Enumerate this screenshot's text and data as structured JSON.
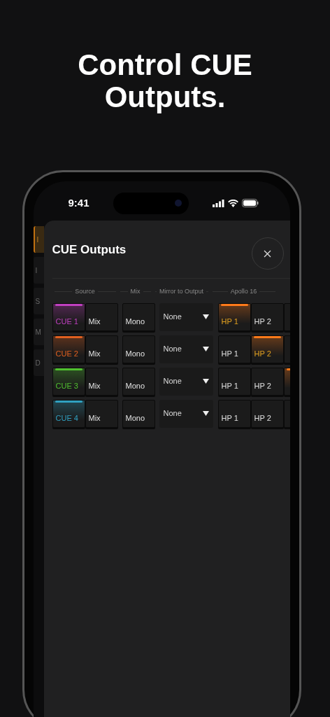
{
  "headline": "Control CUE Outputs.",
  "status_bar": {
    "time": "9:41"
  },
  "background_sidebar": [
    {
      "label": "I",
      "selected": true
    },
    {
      "label": "I",
      "selected": false
    },
    {
      "label": "S",
      "selected": false
    },
    {
      "label": "M",
      "selected": false
    },
    {
      "label": "D",
      "selected": false
    }
  ],
  "sheet": {
    "title": "CUE Outputs",
    "columns": [
      "Source",
      "Mix",
      "Mirror to Output",
      "Apollo 16"
    ],
    "rows": [
      {
        "source": {
          "label": "CUE 1",
          "color": "#c040c0"
        },
        "mix": "Mix",
        "mode": "Mono",
        "mirror": "None",
        "outputs": [
          {
            "label": "HP 1",
            "selected": true
          },
          {
            "label": "HP 2",
            "selected": false
          },
          {
            "selected": false
          }
        ]
      },
      {
        "source": {
          "label": "CUE 2",
          "color": "#e06020"
        },
        "mix": "Mix",
        "mode": "Mono",
        "mirror": "None",
        "outputs": [
          {
            "label": "HP 1",
            "selected": false
          },
          {
            "label": "HP 2",
            "selected": true
          },
          {
            "selected": false
          }
        ]
      },
      {
        "source": {
          "label": "CUE 3",
          "color": "#50c030"
        },
        "mix": "Mix",
        "mode": "Mono",
        "mirror": "None",
        "outputs": [
          {
            "label": "HP 1",
            "selected": false
          },
          {
            "label": "HP 2",
            "selected": false
          },
          {
            "selected": true
          }
        ]
      },
      {
        "source": {
          "label": "CUE 4",
          "color": "#30a0c0"
        },
        "mix": "Mix",
        "mode": "Mono",
        "mirror": "None",
        "outputs": [
          {
            "label": "HP 1",
            "selected": false
          },
          {
            "label": "HP 2",
            "selected": false
          },
          {
            "selected": false
          }
        ]
      }
    ]
  }
}
